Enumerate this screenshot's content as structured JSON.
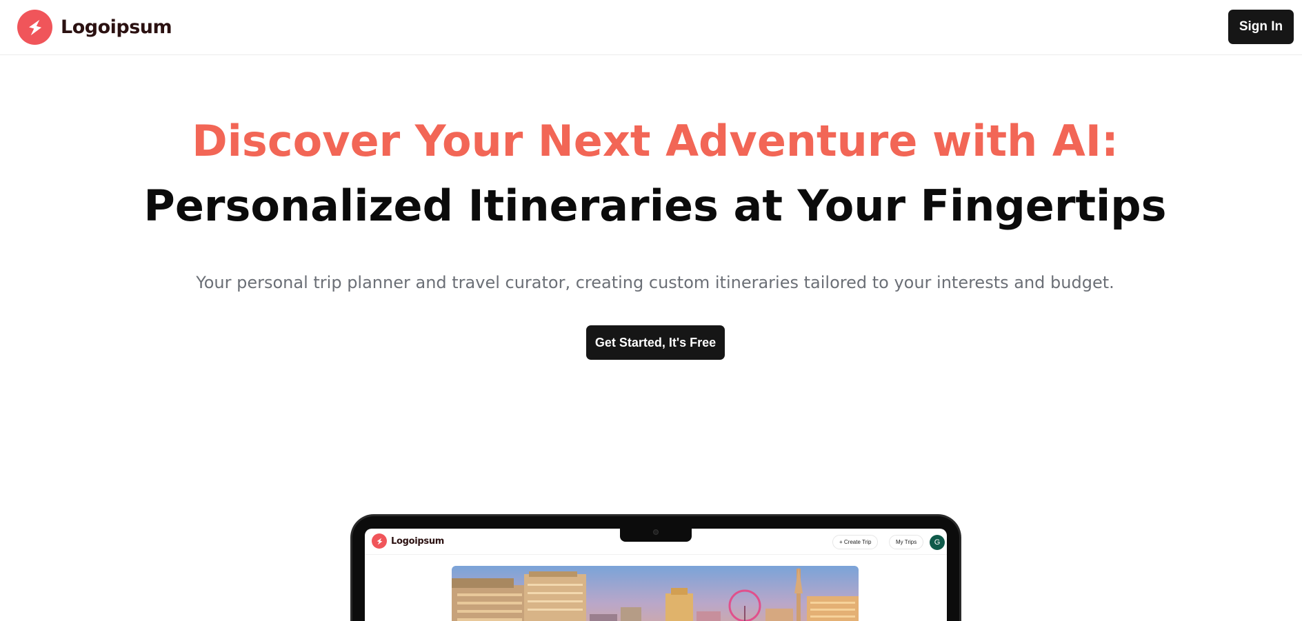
{
  "header": {
    "brand_name": "Logoipsum",
    "sign_in_label": "Sign In"
  },
  "hero": {
    "headline_accent": "Discover Your Next Adventure with AI:",
    "headline_main": "Personalized Itineraries at Your Fingertips",
    "subtitle": "Your personal trip planner and travel curator, creating custom itineraries tailored to your interests and budget.",
    "cta_label": "Get Started, It's Free"
  },
  "preview": {
    "brand_name": "Logoipsum",
    "create_trip_label": "+ Create Trip",
    "my_trips_label": "My Trips",
    "avatar_initial": "G"
  },
  "colors": {
    "accent": "#f26656",
    "logo": "#f0555a",
    "button_dark": "#161616",
    "avatar": "#0f5a4a"
  },
  "icons": {
    "logo": "lightning-bolt-icon"
  }
}
